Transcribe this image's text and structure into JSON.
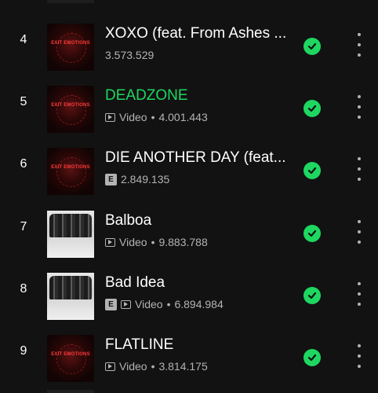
{
  "tracks": [
    {
      "index": "4",
      "title": "XOXO (feat. From Ashes ...",
      "title_color": "#ffffff",
      "art": "exit-emotions-cover",
      "explicit": false,
      "video": false,
      "video_label": "",
      "plays": "3.573.529",
      "downloaded": true
    },
    {
      "index": "5",
      "title": "DEADZONE",
      "title_color": "#1ed760",
      "art": "exit-emotions-cover",
      "explicit": false,
      "video": true,
      "video_label": "Video",
      "plays": "4.001.443",
      "downloaded": true
    },
    {
      "index": "6",
      "title": "DIE ANOTHER DAY (feat...",
      "title_color": "#ffffff",
      "art": "exit-emotions-cover",
      "explicit": true,
      "video": false,
      "video_label": "",
      "plays": "2.849.135",
      "downloaded": true
    },
    {
      "index": "7",
      "title": "Balboa",
      "title_color": "#ffffff",
      "art": "band-photo-cover",
      "explicit": false,
      "video": true,
      "video_label": "Video",
      "plays": "9.883.788",
      "downloaded": true
    },
    {
      "index": "8",
      "title": "Bad Idea",
      "title_color": "#ffffff",
      "art": "band-photo-cover",
      "explicit": true,
      "video": true,
      "video_label": "Video",
      "plays": "6.894.984",
      "downloaded": true
    },
    {
      "index": "9",
      "title": "FLATLINE",
      "title_color": "#ffffff",
      "art": "exit-emotions-cover",
      "explicit": false,
      "video": true,
      "video_label": "Video",
      "plays": "3.814.175",
      "downloaded": true
    }
  ],
  "explicit_badge": "E",
  "cover_text": {
    "exit": "EXIT EMOTIONS"
  },
  "colors": {
    "background": "#121212",
    "accent": "#1ed760",
    "secondary_text": "#b3b3b3"
  }
}
